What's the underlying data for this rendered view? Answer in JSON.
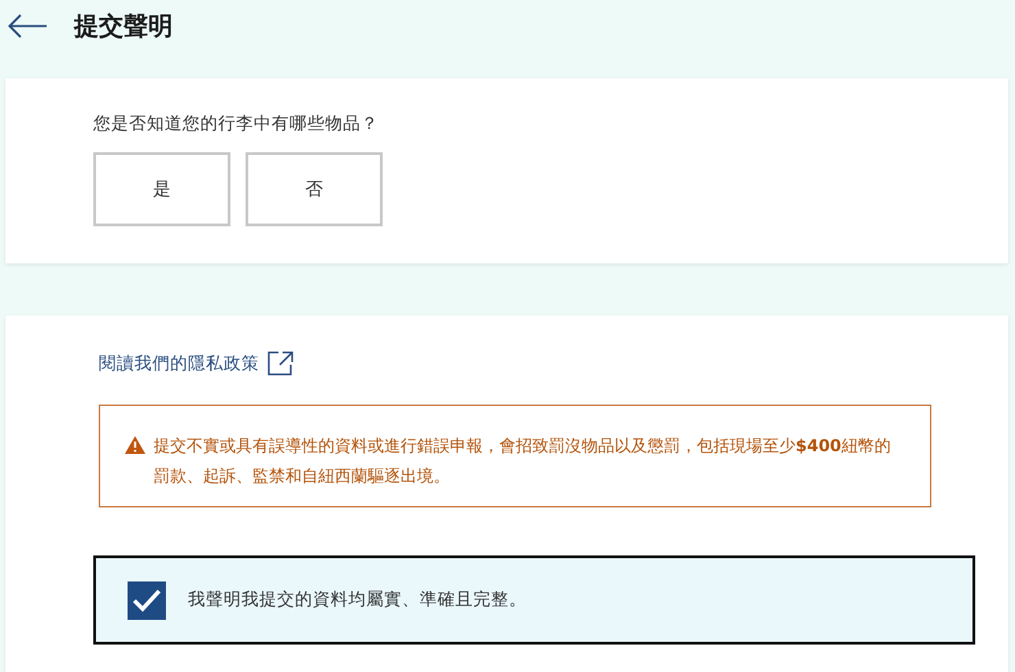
{
  "header": {
    "title": "提交聲明"
  },
  "question": {
    "text": "您是否知道您的行李中有哪些物品？",
    "options": [
      {
        "label": "是",
        "selected": false
      },
      {
        "label": "否",
        "selected": false
      }
    ]
  },
  "privacy_link": "閱讀我們的隱私政策",
  "warning": "提交不實或具有誤導性的資料或進行錯誤申報，會招致罰沒物品以及懲罰，包括現場至少**$400**紐幣的罰款、起訴、監禁和自紐西蘭驅逐出境。",
  "declaration": {
    "label": "我聲明我提交的資料均屬實、準確且完整。",
    "checked": true
  }
}
